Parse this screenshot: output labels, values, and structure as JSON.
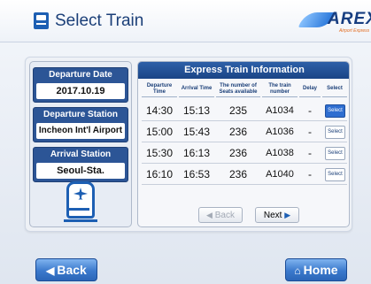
{
  "header": {
    "title": "Select Train",
    "logo": {
      "text": "AREX",
      "subtitle": "Airport Express"
    }
  },
  "trip": {
    "departure_date": {
      "label": "Departure Date",
      "value": "2017.10.19"
    },
    "departure_station": {
      "label": "Departure Station",
      "value": "Incheon Int'l Airport"
    },
    "arrival_station": {
      "label": "Arrival Station",
      "value": "Seoul-Sta."
    }
  },
  "table": {
    "title": "Express Train Information",
    "headers": {
      "departure": "Departure Time",
      "arrival": "Arrival Time",
      "seats": "The number of Seats available",
      "train": "The train number",
      "delay": "Delay",
      "select": "Select"
    },
    "rows": [
      {
        "departure": "14:30",
        "arrival": "15:13",
        "seats": "235",
        "train": "A1034",
        "delay": "-",
        "select": "Select",
        "selected": true
      },
      {
        "departure": "15:00",
        "arrival": "15:43",
        "seats": "236",
        "train": "A1036",
        "delay": "-",
        "select": "Select",
        "selected": false
      },
      {
        "departure": "15:30",
        "arrival": "16:13",
        "seats": "236",
        "train": "A1038",
        "delay": "-",
        "select": "Select",
        "selected": false
      },
      {
        "departure": "16:10",
        "arrival": "16:53",
        "seats": "236",
        "train": "A1040",
        "delay": "-",
        "select": "Select",
        "selected": false
      }
    ],
    "pager": {
      "back": "Back",
      "next": "Next"
    }
  },
  "footer": {
    "back": "Back",
    "home": "Home"
  },
  "icons": {
    "title": "ticket-icon",
    "train": "airport-train-icon",
    "back": "left-arrow-icon",
    "home": "home-icon"
  },
  "colors": {
    "accent": "#1d5fb3",
    "header_bar": "#2c5596",
    "selected": "#2f6ed0"
  }
}
